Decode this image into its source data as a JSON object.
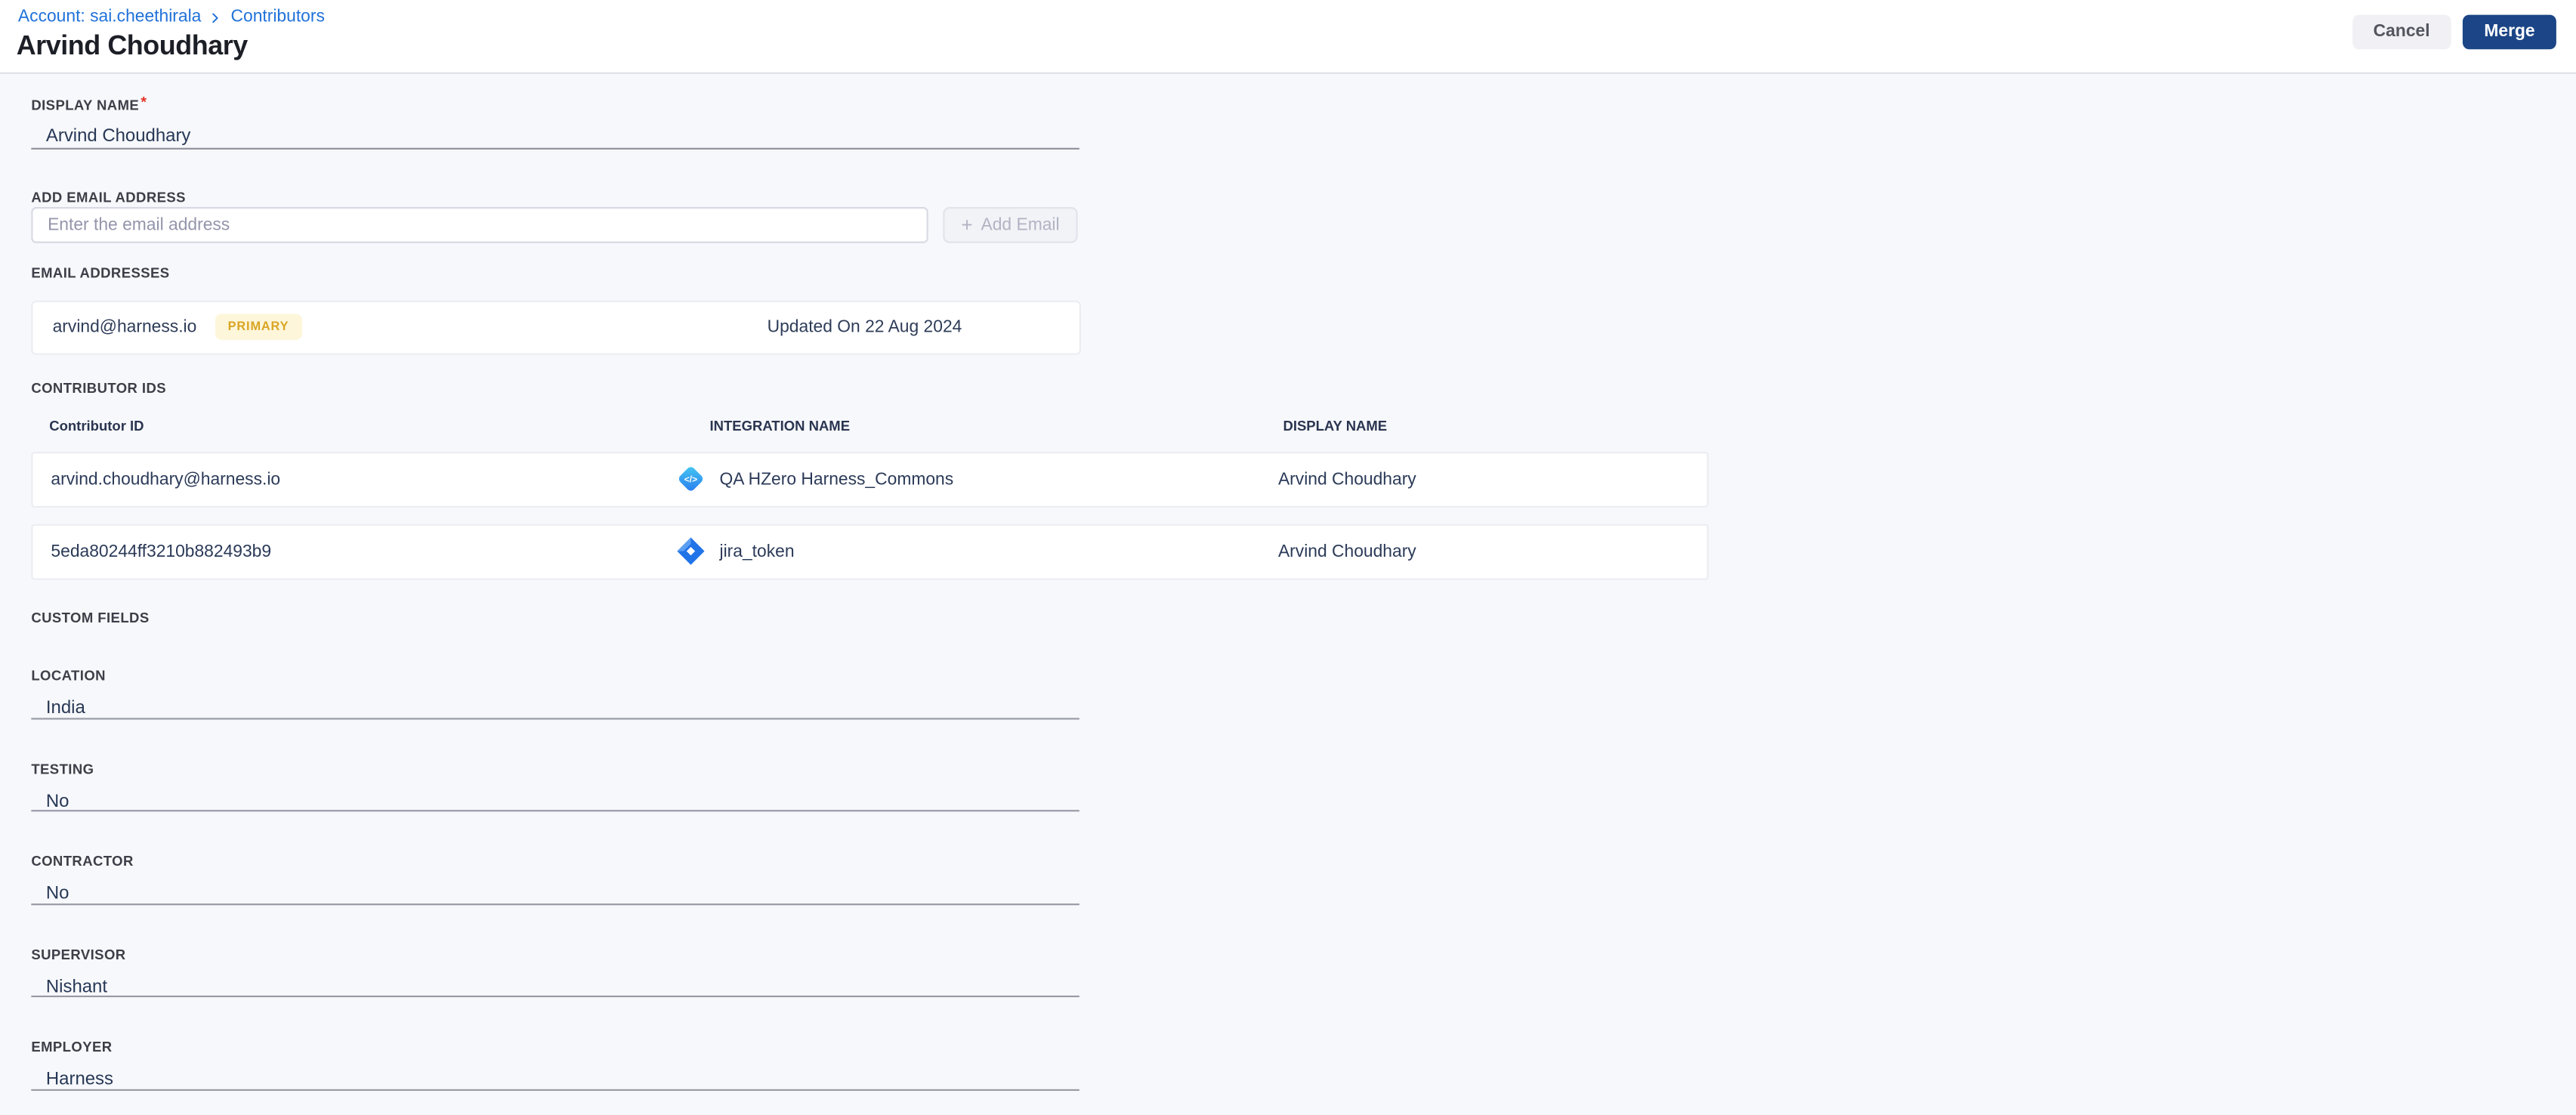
{
  "breadcrumb": {
    "account_label": "Account: sai.cheethirala",
    "section_label": "Contributors"
  },
  "header": {
    "title": "Arvind Choudhary",
    "cancel_label": "Cancel",
    "merge_label": "Merge"
  },
  "display_name": {
    "label": "DISPLAY NAME",
    "required_mark": "*",
    "value": "Arvind Choudhary"
  },
  "add_email": {
    "label": "ADD EMAIL ADDRESS",
    "placeholder": "Enter the email address",
    "plus": "+",
    "button_label": "Add Email"
  },
  "email_addresses": {
    "label": "EMAIL ADDRESSES",
    "items": [
      {
        "email": "arvind@harness.io",
        "badge": "PRIMARY",
        "updated": "Updated On 22 Aug 2024"
      }
    ]
  },
  "contributor_ids": {
    "label": "CONTRIBUTOR IDS",
    "columns": {
      "id": "Contributor ID",
      "integration": "INTEGRATION NAME",
      "display": "DISPLAY NAME"
    },
    "rows": [
      {
        "id": "arvind.choudhary@harness.io",
        "icon": "code-integration-icon",
        "integration": "QA HZero Harness_Commons",
        "display": "Arvind Choudhary"
      },
      {
        "id": "5eda80244ff3210b882493b9",
        "icon": "jira-icon",
        "integration": "jira_token",
        "display": "Arvind Choudhary"
      }
    ]
  },
  "custom_fields": {
    "label": "CUSTOM FIELDS",
    "fields": [
      {
        "label": "LOCATION",
        "value": "India"
      },
      {
        "label": "TESTING",
        "value": "No"
      },
      {
        "label": "CONTRACTOR",
        "value": "No"
      },
      {
        "label": "SUPERVISOR",
        "value": "Nishant"
      },
      {
        "label": "EMPLOYER",
        "value": "Harness"
      }
    ]
  },
  "icons": {
    "breadcrumb_separator": "chevron-right-icon",
    "add_email_button": "plus-icon",
    "row_0": "code-integration-icon",
    "row_1": "jira-icon"
  },
  "colors": {
    "accent_blue": "#2071d9",
    "merge_button_bg": "#1b4586",
    "cancel_button_bg": "#f0f0f5",
    "content_bg": "#f7f8fb",
    "badge_bg": "#fdf6da",
    "badge_text": "#d9a524",
    "value_text": "#2b3a58",
    "label_text": "#3d3e47",
    "required_mark": "#e43326"
  }
}
